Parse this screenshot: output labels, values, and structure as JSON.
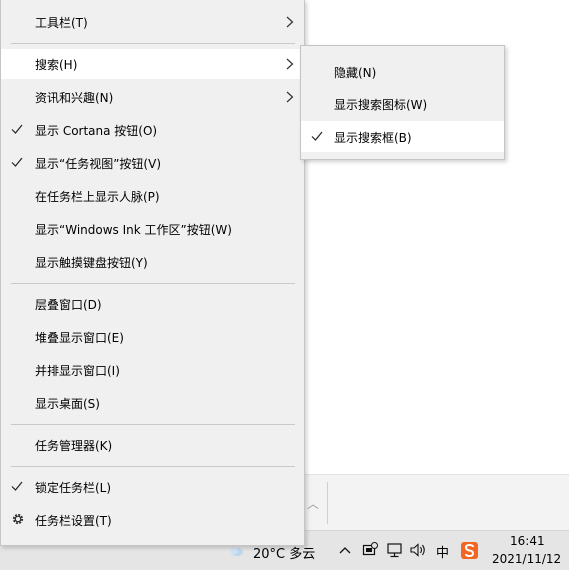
{
  "context_menu": {
    "items": [
      {
        "label": "工具栏(T)",
        "has_submenu": true
      },
      {
        "label": "搜索(H)",
        "has_submenu": true,
        "highlighted": true
      },
      {
        "label": "资讯和兴趣(N)",
        "has_submenu": true
      },
      {
        "label": "显示 Cortana 按钮(O)",
        "checked": true
      },
      {
        "label": "显示“任务视图”按钮(V)",
        "checked": true
      },
      {
        "label": "在任务栏上显示人脉(P)"
      },
      {
        "label": "显示“Windows Ink 工作区”按钮(W)"
      },
      {
        "label": "显示触摸键盘按钮(Y)"
      },
      {
        "label": "层叠窗口(D)"
      },
      {
        "label": "堆叠显示窗口(E)"
      },
      {
        "label": "并排显示窗口(I)"
      },
      {
        "label": "显示桌面(S)"
      },
      {
        "label": "任务管理器(K)"
      },
      {
        "label": "锁定任务栏(L)",
        "checked": true
      },
      {
        "label": "任务栏设置(T)",
        "icon": "gear-icon"
      }
    ]
  },
  "search_submenu": {
    "items": [
      {
        "label": "隐藏(N)"
      },
      {
        "label": "显示搜索图标(W)"
      },
      {
        "label": "显示搜索框(B)",
        "checked": true,
        "highlighted": true
      }
    ]
  },
  "taskbar": {
    "weather": "20°C  多云",
    "ime_label": "中",
    "time": "16:41",
    "date": "2021/11/12",
    "icons": [
      "weather-icon",
      "chevron-up-icon",
      "security-center-icon",
      "network-icon",
      "volume-icon",
      "ime-icon",
      "sogou-input-icon"
    ]
  },
  "colors": {
    "menu_bg": "#f0f0f0",
    "highlight_bg": "#ffffff",
    "taskbar_bg": "#e5e5e5",
    "sogou_orange": "#f26522"
  }
}
